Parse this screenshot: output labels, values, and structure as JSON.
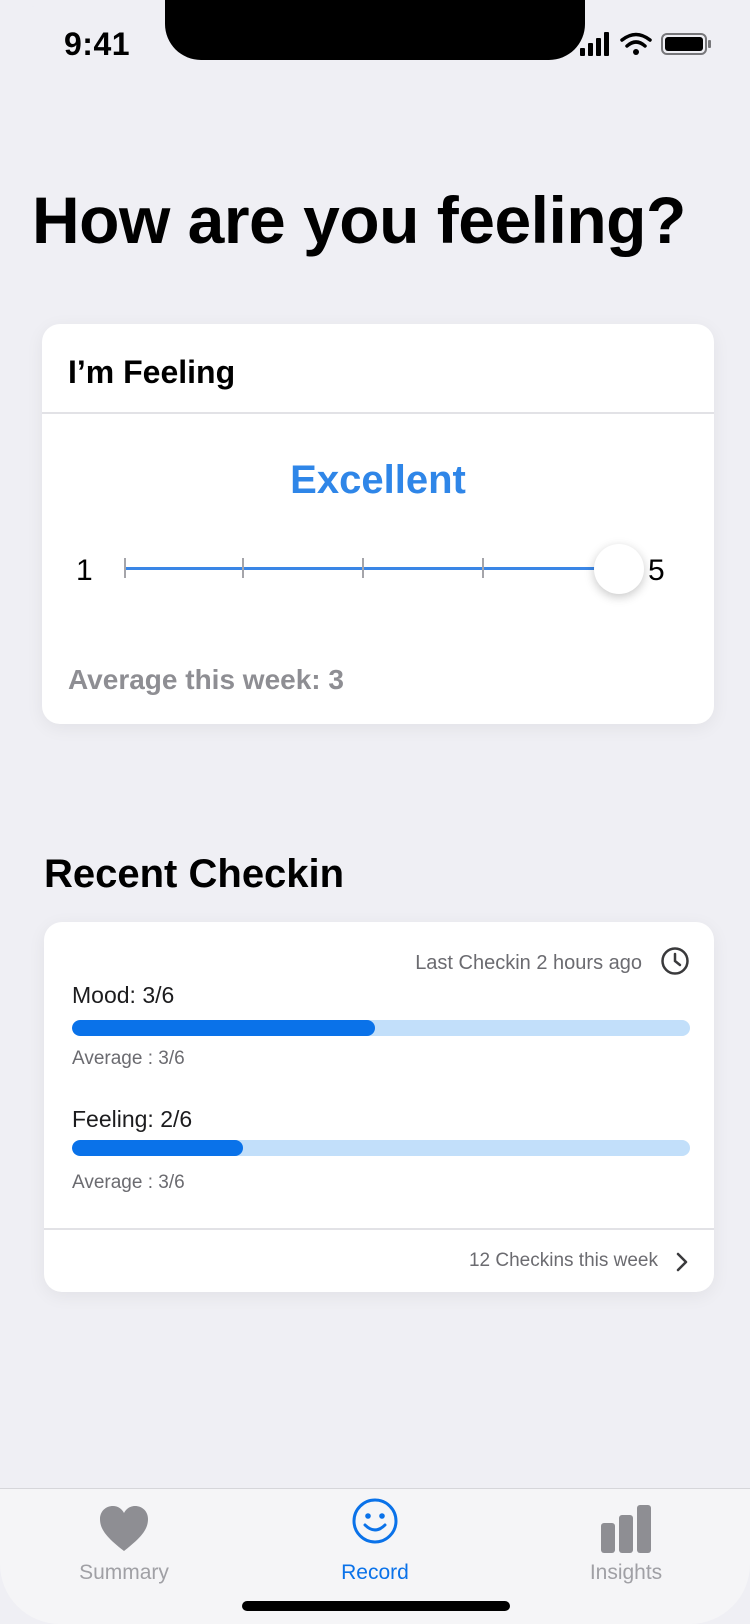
{
  "status_bar": {
    "time": "9:41"
  },
  "page": {
    "title": "How are you feeling?"
  },
  "feeling_card": {
    "header": "I’m Feeling",
    "current_value_label": "Excellent",
    "slider": {
      "min_label": "1",
      "max_label": "5",
      "value": 5
    },
    "average_text": "Average this week: 3"
  },
  "recent": {
    "section_title": "Recent Checkin",
    "last_checkin": "Last Checkin 2 hours ago",
    "metrics": [
      {
        "label": "Mood: 3/6",
        "fraction": 0.49,
        "average": "Average : 3/6"
      },
      {
        "label": "Feeling: 2/6",
        "fraction": 0.277,
        "average": "Average : 3/6"
      }
    ],
    "footer_link": "12 Checkins this week"
  },
  "tabs": [
    {
      "label": "Summary",
      "icon": "heart-icon",
      "active": false
    },
    {
      "label": "Record",
      "icon": "smiley-icon",
      "active": true
    },
    {
      "label": "Insights",
      "icon": "bar-chart-icon",
      "active": false
    }
  ],
  "colors": {
    "accent": "#0a72e9",
    "value_blue": "#2f86e8",
    "bar_track": "#c2dffa",
    "inactive": "#a0a0a5"
  }
}
